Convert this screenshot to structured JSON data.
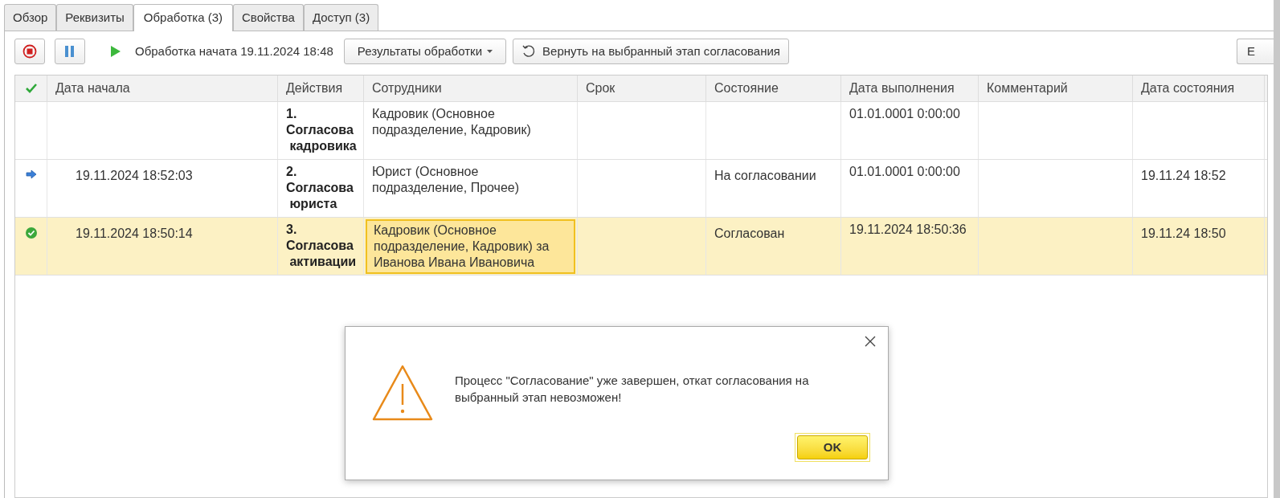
{
  "tabs": [
    {
      "label": "Обзор",
      "selected": false
    },
    {
      "label": "Реквизиты",
      "selected": false
    },
    {
      "label": "Обработка (3)",
      "selected": true
    },
    {
      "label": "Свойства",
      "selected": false
    },
    {
      "label": "Доступ (3)",
      "selected": false
    }
  ],
  "toolbar": {
    "status_text": "Обработка начата 19.11.2024 18:48",
    "results_button": "Результаты обработки",
    "return_button": "Вернуть на выбранный этап согласования",
    "more_button": "Е"
  },
  "table": {
    "columns": [
      "Дата начала",
      "Действия",
      "Сотрудники",
      "Срок",
      "Состояние",
      "Дата выполнения",
      "Комментарий",
      "Дата состояния"
    ],
    "rows": [
      {
        "kind": "plain",
        "selected": false,
        "start": "",
        "action": [
          "1.",
          "Согласова",
          "кадровика"
        ],
        "employees": "Кадровик (Основное подразделение, Кадровик)",
        "deadline": "",
        "state": "",
        "done": "01.01.0001 0:00:00",
        "comment": "",
        "state_date": ""
      },
      {
        "kind": "current",
        "selected": false,
        "start": "19.11.2024 18:52:03",
        "action": [
          "2.",
          "Согласова",
          "юриста"
        ],
        "employees": "Юрист (Основное подразделение, Прочее)",
        "deadline": "",
        "state": "На согласовании",
        "done": "01.01.0001 0:00:00",
        "comment": "",
        "state_date": "19.11.24 18:52"
      },
      {
        "kind": "done",
        "selected": true,
        "start": "19.11.2024 18:50:14",
        "action": [
          "3.",
          "Согласова",
          "активации"
        ],
        "employees": "Кадровик (Основное подразделение, Кадровик) за Иванова Ивана Ивановича",
        "deadline": "",
        "state": "Согласован",
        "done": "19.11.2024 18:50:36",
        "comment": "",
        "state_date": "19.11.24 18:50"
      }
    ]
  },
  "dialog": {
    "message": "Процесс \"Согласование\" уже завершен, откат согласования на выбранный этап невозможен!",
    "ok_button": "OK"
  }
}
